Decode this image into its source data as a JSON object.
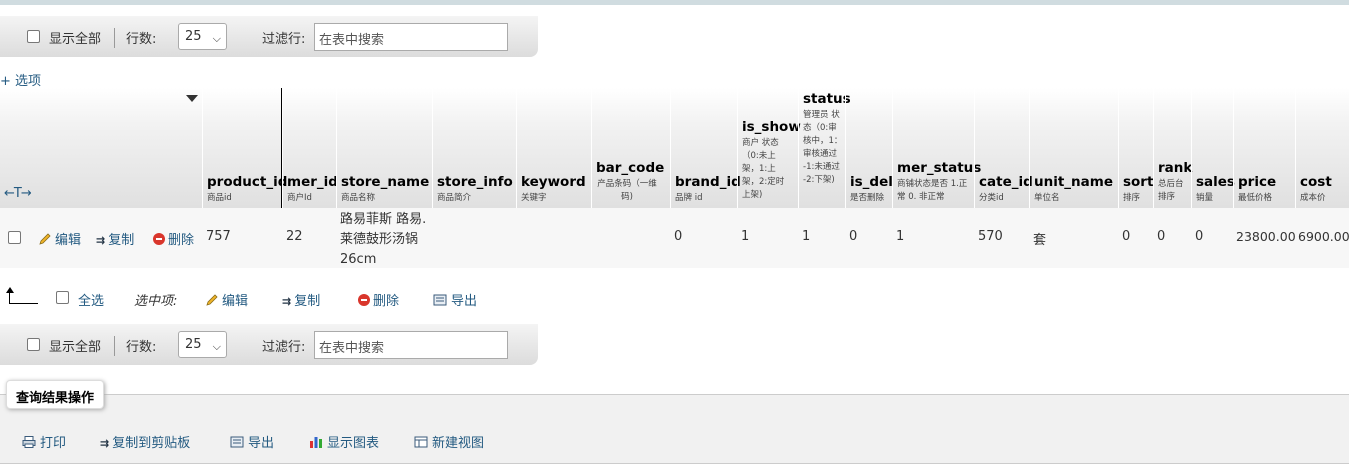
{
  "nav": {
    "show_all": "显示全部",
    "rows_label": "行数:",
    "rows_value": "25",
    "filter_label": "过滤行:",
    "filter_placeholder": "在表中搜索"
  },
  "options_link": "+ 选项",
  "columns": [
    {
      "name": "product_id",
      "comment": "商品id"
    },
    {
      "name": "mer_id",
      "comment": "商户Id"
    },
    {
      "name": "store_name",
      "comment": "商品名称"
    },
    {
      "name": "store_info",
      "comment": "商品简介"
    },
    {
      "name": "keyword",
      "comment": "关键字"
    },
    {
      "name": "bar_code",
      "comment": "产品条码（一维码)"
    },
    {
      "name": "brand_id",
      "comment": "品牌 id"
    },
    {
      "name": "is_show",
      "comment": "商户 状态（0:未上架，1:上架，2:定时上架)"
    },
    {
      "name": "status",
      "comment": "管理员 状态（0:审核中，1：审核通过 -1:未通过 -2:下架)"
    },
    {
      "name": "is_del",
      "comment": "是否删除"
    },
    {
      "name": "mer_status",
      "comment": "商铺状态是否 1.正常 0. 非正常"
    },
    {
      "name": "cate_id",
      "comment": "分类id"
    },
    {
      "name": "unit_name",
      "comment": "单位名"
    },
    {
      "name": "sort",
      "comment": "排序"
    },
    {
      "name": "rank",
      "comment": "总后台排序"
    },
    {
      "name": "sales",
      "comment": "销量"
    },
    {
      "name": "price",
      "comment": "最低价格"
    },
    {
      "name": "cost",
      "comment": "成本价"
    }
  ],
  "row_actions": {
    "edit": "编辑",
    "copy": "复制",
    "delete": "删除"
  },
  "row": {
    "product_id": "757",
    "mer_id": "22",
    "store_name": "路易菲斯 路易.莱德鼓形汤锅26cm",
    "store_info": "",
    "keyword": "",
    "bar_code": "",
    "brand_id": "0",
    "is_show": "1",
    "status": "1",
    "is_del": "0",
    "mer_status": "1",
    "cate_id": "570",
    "unit_name": "套",
    "sort": "0",
    "rank": "0",
    "sales": "0",
    "price": "23800.00",
    "cost": "6900.00"
  },
  "bulk": {
    "select_all": "全选",
    "selected_label": "选中项:",
    "edit": "编辑",
    "copy": "复制",
    "delete": "删除",
    "export": "导出"
  },
  "query_ops": {
    "title": "查询结果操作",
    "print": "打印",
    "copy_clipboard": "复制到剪贴板",
    "export": "导出",
    "chart": "显示图表",
    "new_view": "新建视图"
  }
}
